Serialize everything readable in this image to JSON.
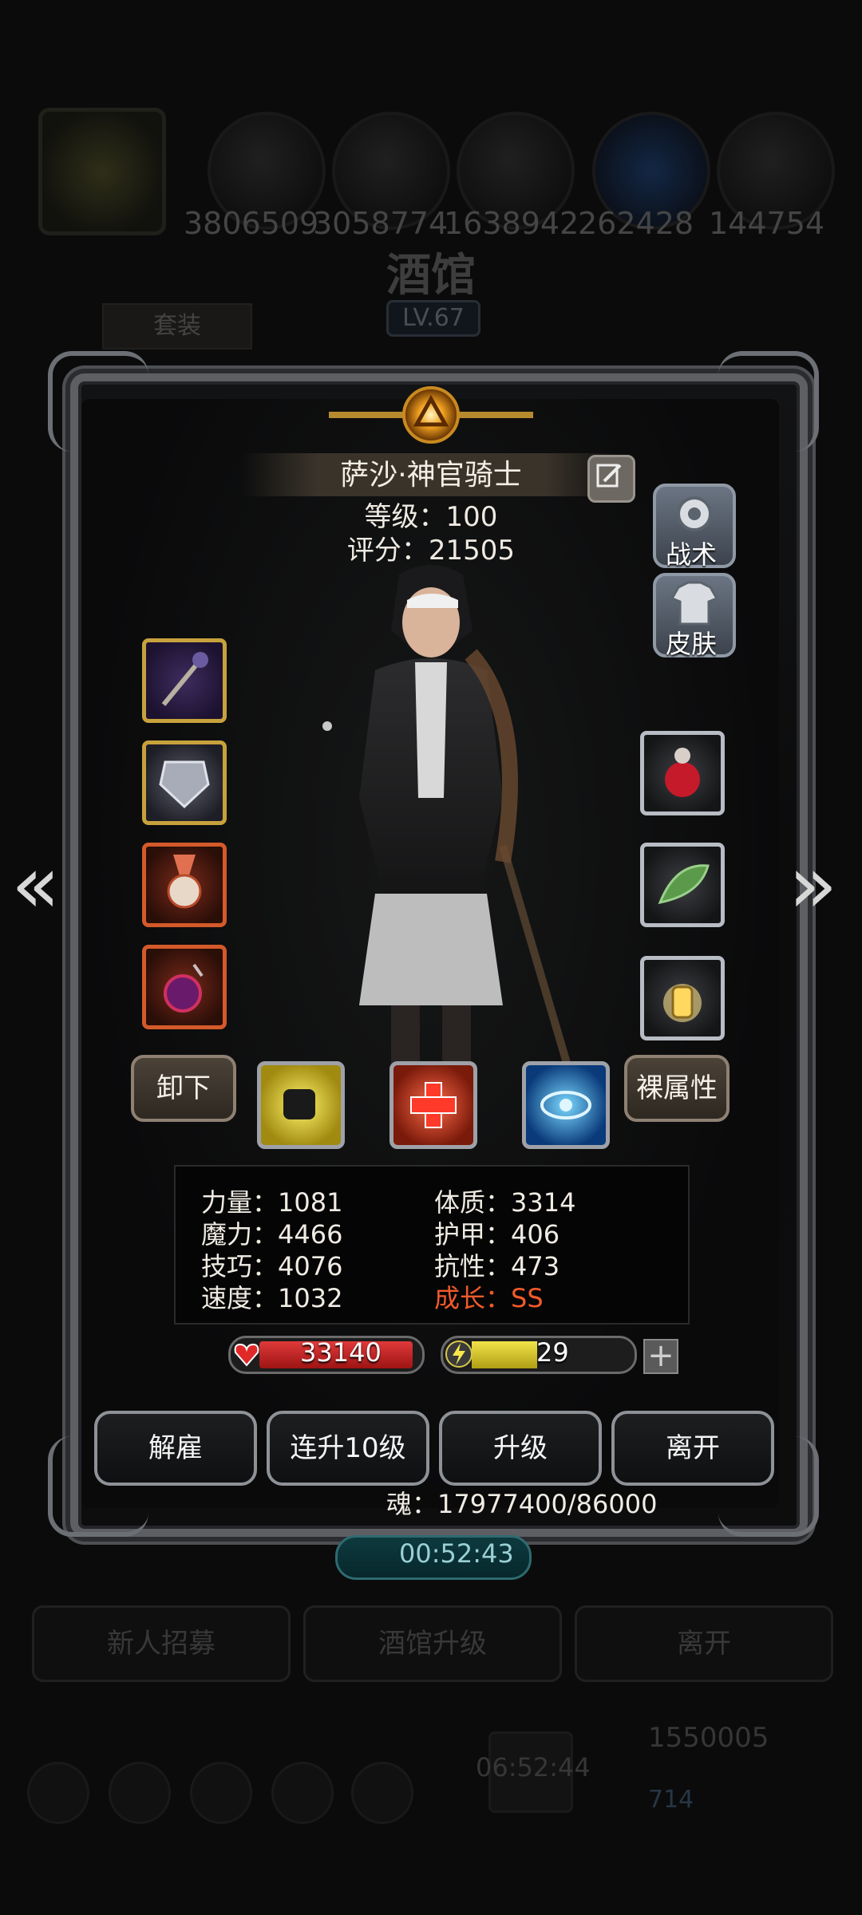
{
  "background": {
    "resource_counts": [
      "3806509",
      "3058774",
      "1638942",
      "262428",
      "144754"
    ],
    "title": "酒馆",
    "level_badge": "LV.67",
    "suit_tab": "套装",
    "bottom_buttons": [
      "新人招募",
      "酒馆升级",
      "离开"
    ],
    "gold_amount": "1550005",
    "gem_amount": "714",
    "timer_secondary": "06:52:44"
  },
  "hero": {
    "name": "萨沙·神官骑士",
    "level_text": "等级：100",
    "score_text": "评分：21505"
  },
  "side_buttons": {
    "tactics": "战术",
    "skin": "皮肤"
  },
  "buttons": {
    "unequip": "卸下",
    "naked_attrs": "裸属性"
  },
  "stats": {
    "strength": "力量：1081",
    "magic": "魔力：4466",
    "skill": "技巧：4076",
    "speed": "速度：1032",
    "constitution": "体质：3314",
    "armor": "护甲：406",
    "resistance": "抗性：473",
    "growth": "成长：SS"
  },
  "bars": {
    "hp": "33140",
    "energy": "29",
    "energy_fraction": 0.42
  },
  "actions": [
    "解雇",
    "连升10级",
    "升级",
    "离开"
  ],
  "soul_text": "魂：17977400/86000",
  "timer": "00:52:43",
  "colors": {
    "growth_highlight": "#f05a2a",
    "hp_fill": "#d42a2a",
    "energy_fill": "#e8d83a"
  }
}
